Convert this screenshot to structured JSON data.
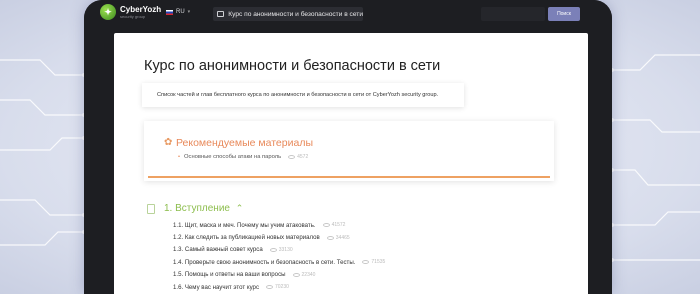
{
  "app": {
    "logo_name": "CyberYozh",
    "logo_sub": "security group",
    "language": "RU",
    "tab_title": "Курс по анонимности и безопасности в сети"
  },
  "search": {
    "placeholder": "",
    "button_label": "Поиск"
  },
  "page": {
    "title": "Курс по анонимности и безопасности в сети",
    "intro": "Список частей и глав бесплатного курса по анонимности и безопасности в сети от CyberYozh security group."
  },
  "recommended": {
    "title": "Рекомендуемые материалы",
    "items": [
      {
        "label": "Основные способы атаки на пароль",
        "views": "4572"
      }
    ]
  },
  "section": {
    "title": "1. Вступление",
    "lessons": [
      {
        "label": "1.1. Щит, маска и меч. Почему мы учим атаковать.",
        "views": "41572"
      },
      {
        "label": "1.2. Как следить за публикацией новых материалов",
        "views": "34465"
      },
      {
        "label": "1.3. Самый важный совет курса",
        "views": "33130"
      },
      {
        "label": "1.4. Проверьте свою анонимность и безопасность в сети. Тесты.",
        "views": "71535"
      },
      {
        "label": "1.5. Помощь и ответы на ваши вопросы",
        "views": "22340"
      },
      {
        "label": "1.6. Чему вас научит этот курс",
        "views": "70230"
      }
    ]
  },
  "colors": {
    "accent_orange": "#e8895a",
    "accent_green": "#8cbd4c",
    "search_button": "#7b80b8"
  }
}
